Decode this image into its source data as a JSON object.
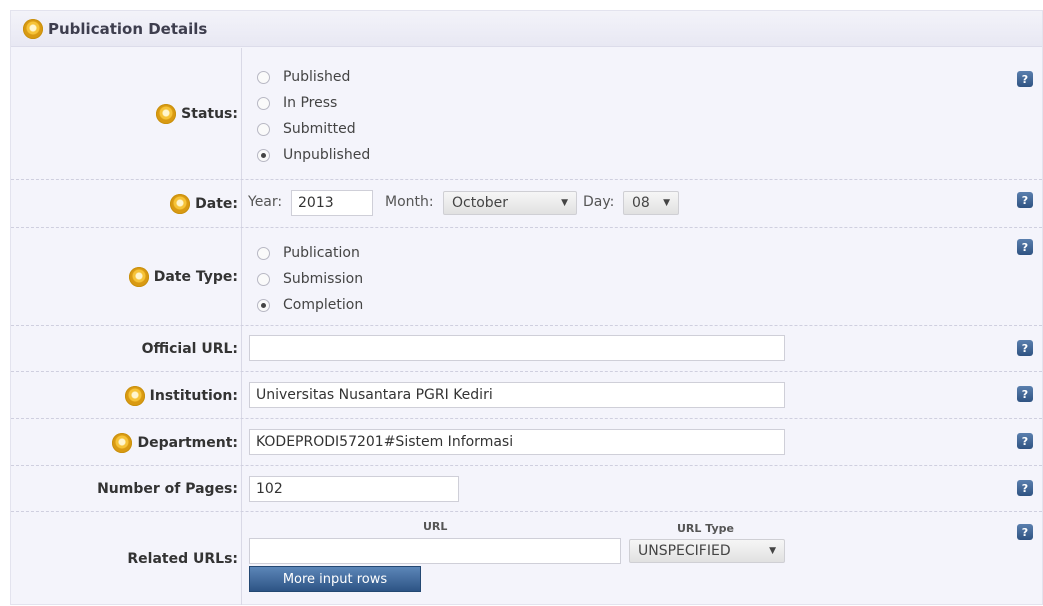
{
  "panel": {
    "title": "Publication Details"
  },
  "help_glyph": "?",
  "status": {
    "label": "Status:",
    "options": [
      "Published",
      "In Press",
      "Submitted",
      "Unpublished"
    ],
    "selected": "Unpublished"
  },
  "date": {
    "label": "Date:",
    "year_label": "Year:",
    "year_value": "2013",
    "month_label": "Month:",
    "month_value": "October",
    "day_label": "Day:",
    "day_value": "08"
  },
  "date_type": {
    "label": "Date Type:",
    "options": [
      "Publication",
      "Submission",
      "Completion"
    ],
    "selected": "Completion"
  },
  "official_url": {
    "label": "Official URL:",
    "value": ""
  },
  "institution": {
    "label": "Institution:",
    "value": "Universitas Nusantara PGRI Kediri"
  },
  "department": {
    "label": "Department:",
    "value": "KODEPRODI57201#Sistem Informasi"
  },
  "pages": {
    "label": "Number of Pages:",
    "value": "102"
  },
  "related_urls": {
    "label": "Related URLs:",
    "url_header": "URL",
    "type_header": "URL Type",
    "url_value": "",
    "type_value": "UNSPECIFIED",
    "more_rows_label": "More input rows"
  }
}
